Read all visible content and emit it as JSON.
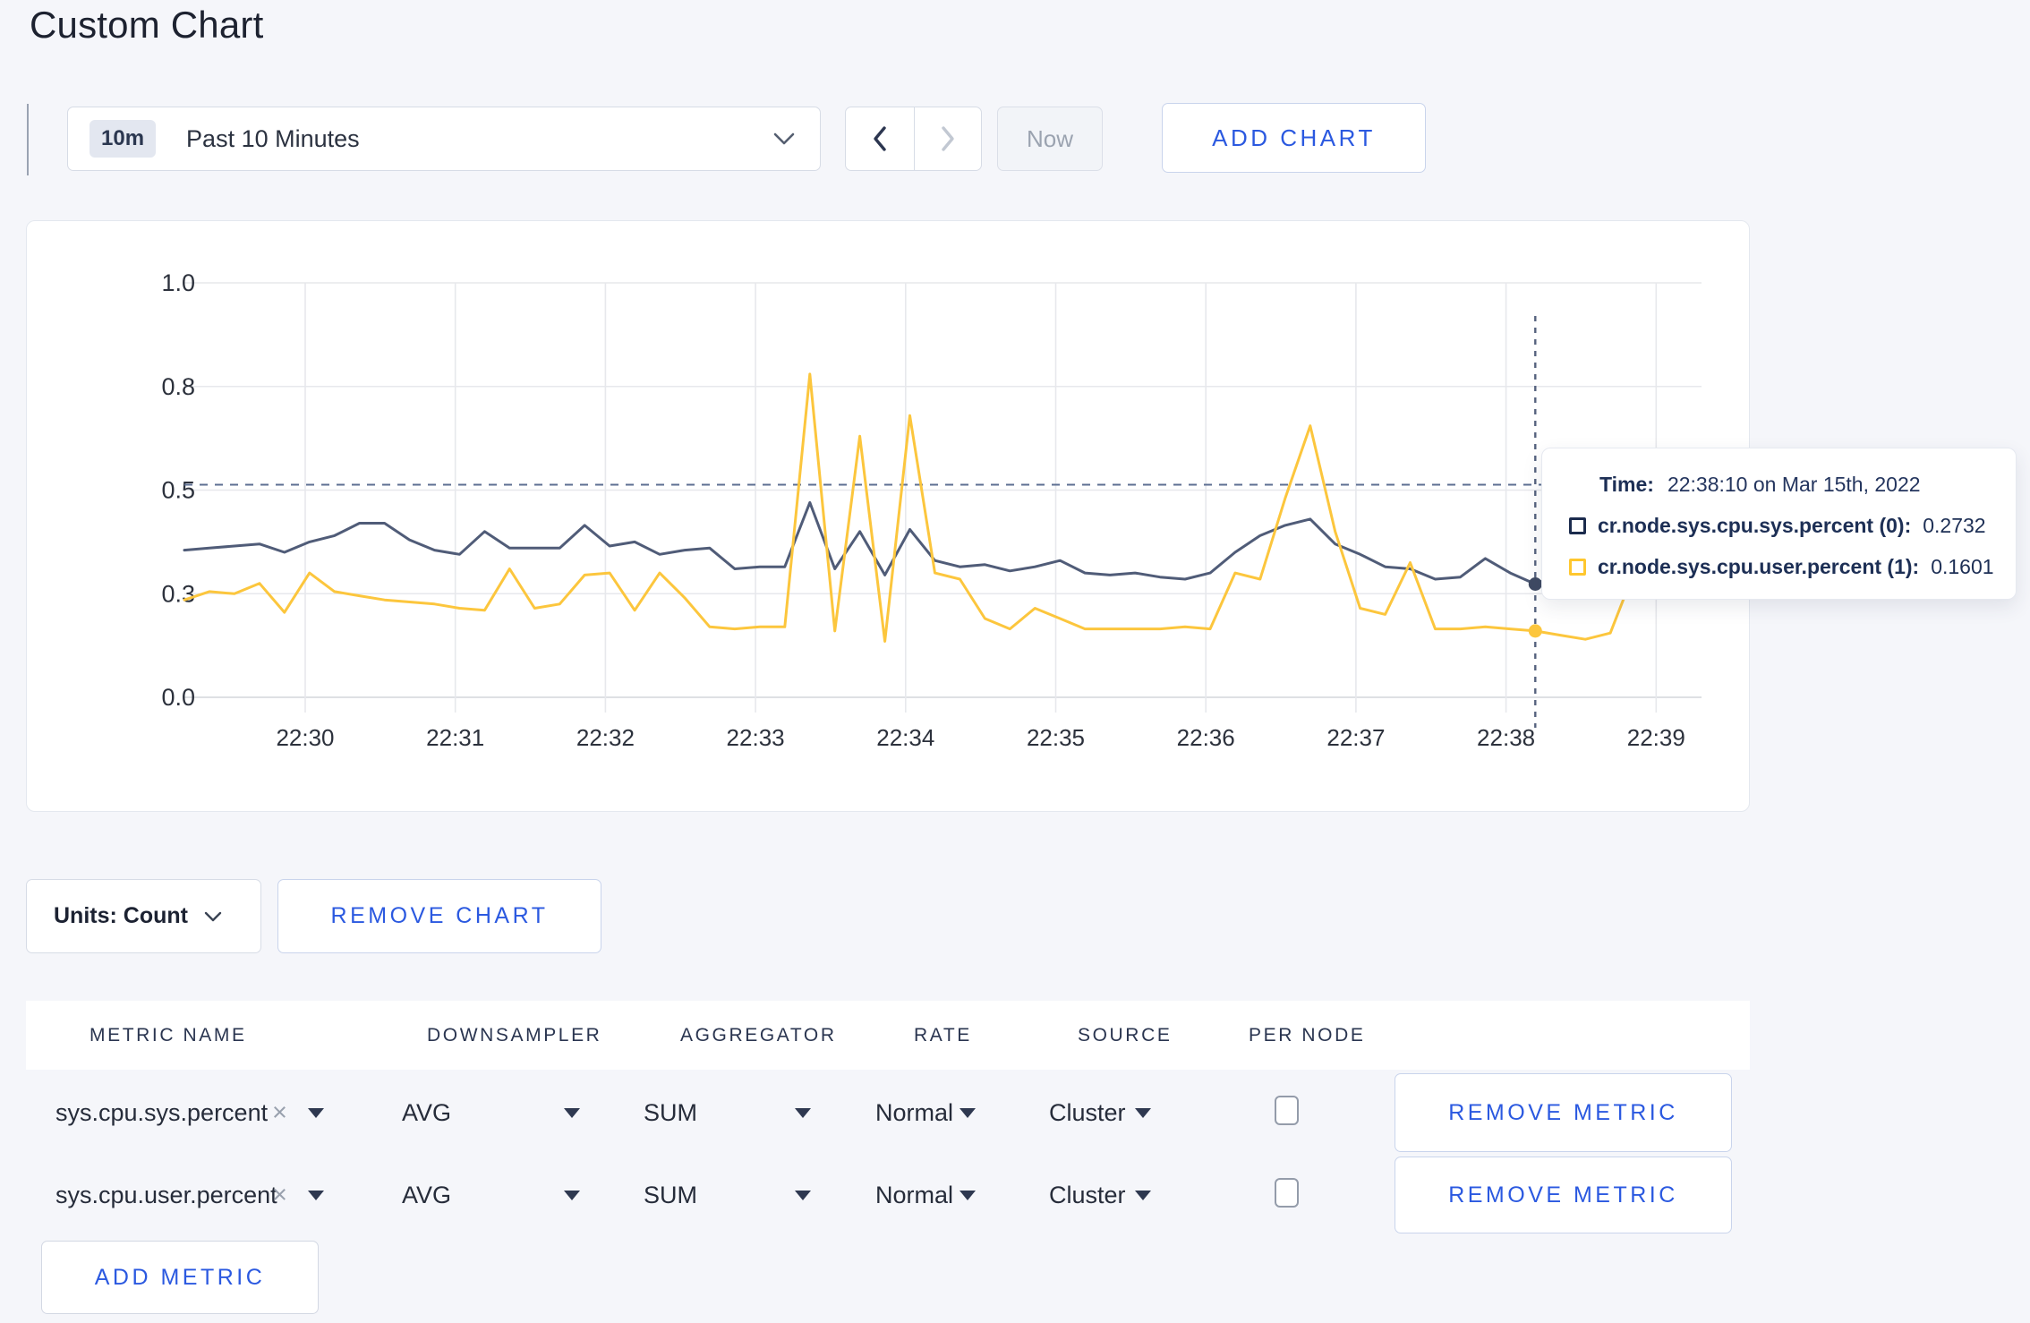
{
  "page": {
    "title": "Custom Chart"
  },
  "toolbar": {
    "time_window_badge": "10m",
    "time_window_label": "Past 10 Minutes",
    "now_label": "Now",
    "add_chart_label": "ADD CHART"
  },
  "chart_data": {
    "type": "line",
    "title": "",
    "xlabel": "",
    "ylabel": "",
    "ylim": [
      0,
      1
    ],
    "grid": true,
    "x_start": "22:29:10",
    "x_step_seconds": 10,
    "x_ticks": [
      "22:30",
      "22:31",
      "22:32",
      "22:33",
      "22:34",
      "22:35",
      "22:36",
      "22:37",
      "22:38",
      "22:39"
    ],
    "first_tick_point_index": 5,
    "points_per_tick": 6,
    "y_ticks": [
      {
        "v": 0.0,
        "label": "0.0"
      },
      {
        "v": 0.25,
        "label": "0.3"
      },
      {
        "v": 0.5,
        "label": "0.5"
      },
      {
        "v": 0.75,
        "label": "0.8"
      },
      {
        "v": 1.0,
        "label": "1.0"
      }
    ],
    "threshold_dashed_value": 0.513,
    "crosshair": {
      "index": 54,
      "time": "22:38:10"
    },
    "series": [
      {
        "name": "cr.node.sys.cpu.sys.percent",
        "color": "#505c78",
        "dot_color": "#3f4a63",
        "values": [
          0.355,
          0.36,
          0.365,
          0.37,
          0.35,
          0.375,
          0.39,
          0.42,
          0.42,
          0.38,
          0.355,
          0.345,
          0.4,
          0.36,
          0.36,
          0.36,
          0.415,
          0.365,
          0.375,
          0.345,
          0.355,
          0.36,
          0.31,
          0.315,
          0.315,
          0.47,
          0.31,
          0.4,
          0.295,
          0.405,
          0.33,
          0.315,
          0.32,
          0.305,
          0.315,
          0.33,
          0.3,
          0.295,
          0.3,
          0.29,
          0.285,
          0.3,
          0.35,
          0.39,
          0.415,
          0.43,
          0.37,
          0.345,
          0.315,
          0.31,
          0.285,
          0.29,
          0.335,
          0.3,
          0.2732,
          0.3,
          0.295,
          0.3,
          0.31,
          0.3
        ]
      },
      {
        "name": "cr.node.sys.cpu.user.percent",
        "color": "#fcc63d",
        "dot_color": "#fcc63d",
        "values": [
          0.235,
          0.255,
          0.25,
          0.275,
          0.205,
          0.3,
          0.255,
          0.245,
          0.235,
          0.23,
          0.225,
          0.215,
          0.21,
          0.31,
          0.215,
          0.225,
          0.295,
          0.3,
          0.21,
          0.3,
          0.24,
          0.17,
          0.165,
          0.17,
          0.17,
          0.78,
          0.16,
          0.63,
          0.135,
          0.68,
          0.3,
          0.285,
          0.19,
          0.165,
          0.215,
          0.19,
          0.165,
          0.165,
          0.165,
          0.165,
          0.17,
          0.165,
          0.3,
          0.285,
          0.48,
          0.655,
          0.4,
          0.215,
          0.2,
          0.325,
          0.165,
          0.165,
          0.17,
          0.165,
          0.1601,
          0.15,
          0.14,
          0.155,
          0.31,
          0.26
        ]
      }
    ],
    "legend_position": "tooltip"
  },
  "tooltip": {
    "time_label": "Time:",
    "time_value": "22:38:10 on Mar 15th, 2022",
    "rows": [
      {
        "name": "cr.node.sys.cpu.sys.percent (0):",
        "value": "0.2732",
        "swatch": "#1b2b4d"
      },
      {
        "name": "cr.node.sys.cpu.user.percent (1):",
        "value": "0.1601",
        "swatch": "#ffc72e"
      }
    ]
  },
  "chart_footer": {
    "units_label": "Units: Count",
    "remove_chart_label": "REMOVE CHART"
  },
  "metrics_table": {
    "headers": [
      "METRIC NAME",
      "DOWNSAMPLER",
      "AGGREGATOR",
      "RATE",
      "SOURCE",
      "PER NODE"
    ],
    "rows": [
      {
        "metric": "sys.cpu.sys.percent",
        "downsampler": "AVG",
        "aggregator": "SUM",
        "rate": "Normal",
        "source": "Cluster",
        "per_node_checked": false,
        "remove_label": "REMOVE METRIC"
      },
      {
        "metric": "sys.cpu.user.percent",
        "downsampler": "AVG",
        "aggregator": "SUM",
        "rate": "Normal",
        "source": "Cluster",
        "per_node_checked": false,
        "remove_label": "REMOVE METRIC"
      }
    ],
    "add_metric_label": "ADD METRIC"
  }
}
